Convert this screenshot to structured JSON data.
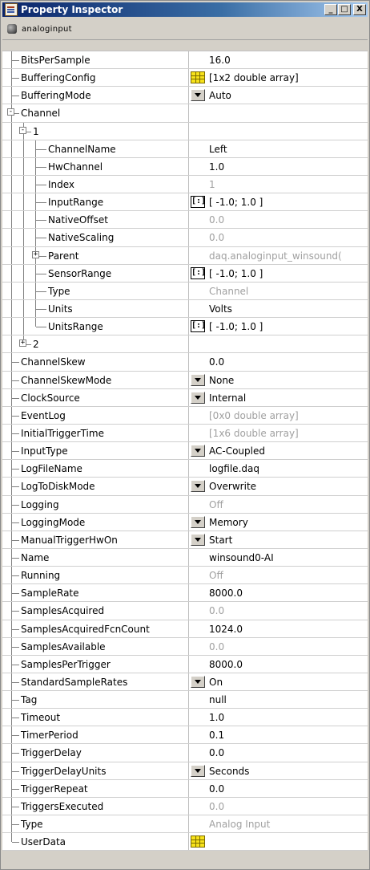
{
  "window": {
    "title": "Property Inspector",
    "controls": [
      "_",
      "□",
      "X"
    ]
  },
  "object": {
    "name": "analoginput",
    "icon": "object-icon"
  },
  "properties": [
    {
      "name": "BitsPerSample",
      "depth": 0,
      "value": "16.0",
      "readonly": false,
      "widget": null
    },
    {
      "name": "BufferingConfig",
      "depth": 0,
      "value": "[1x2  double array]",
      "readonly": false,
      "widget": "table"
    },
    {
      "name": "BufferingMode",
      "depth": 0,
      "value": "Auto",
      "readonly": false,
      "widget": "dropdown"
    },
    {
      "name": "Channel",
      "depth": 0,
      "value": "",
      "readonly": false,
      "widget": null,
      "expander": "-"
    },
    {
      "name": "1",
      "depth": 1,
      "value": "",
      "readonly": false,
      "widget": null,
      "expander": "-"
    },
    {
      "name": "ChannelName",
      "depth": 2,
      "value": "Left",
      "readonly": false,
      "widget": null
    },
    {
      "name": "HwChannel",
      "depth": 2,
      "value": "1.0",
      "readonly": false,
      "widget": null
    },
    {
      "name": "Index",
      "depth": 2,
      "value": "1",
      "readonly": true,
      "widget": null
    },
    {
      "name": "InputRange",
      "depth": 2,
      "value": "[ -1.0; 1.0 ]",
      "readonly": false,
      "widget": "range"
    },
    {
      "name": "NativeOffset",
      "depth": 2,
      "value": "0.0",
      "readonly": true,
      "widget": null
    },
    {
      "name": "NativeScaling",
      "depth": 2,
      "value": "0.0",
      "readonly": true,
      "widget": null
    },
    {
      "name": "Parent",
      "depth": 2,
      "value": "daq.analoginput_winsound(",
      "readonly": true,
      "widget": null,
      "expander": "+"
    },
    {
      "name": "SensorRange",
      "depth": 2,
      "value": "[ -1.0; 1.0 ]",
      "readonly": false,
      "widget": "range"
    },
    {
      "name": "Type",
      "depth": 2,
      "value": "Channel",
      "readonly": true,
      "widget": null
    },
    {
      "name": "Units",
      "depth": 2,
      "value": "Volts",
      "readonly": false,
      "widget": null
    },
    {
      "name": "UnitsRange",
      "depth": 2,
      "value": "[ -1.0; 1.0 ]",
      "readonly": false,
      "widget": "range"
    },
    {
      "name": "2",
      "depth": 1,
      "value": "",
      "readonly": false,
      "widget": null,
      "expander": "+"
    },
    {
      "name": "ChannelSkew",
      "depth": 0,
      "value": "0.0",
      "readonly": false,
      "widget": null
    },
    {
      "name": "ChannelSkewMode",
      "depth": 0,
      "value": "None",
      "readonly": false,
      "widget": "dropdown"
    },
    {
      "name": "ClockSource",
      "depth": 0,
      "value": "Internal",
      "readonly": false,
      "widget": "dropdown"
    },
    {
      "name": "EventLog",
      "depth": 0,
      "value": "[0x0  double array]",
      "readonly": true,
      "widget": null
    },
    {
      "name": "InitialTriggerTime",
      "depth": 0,
      "value": "[1x6  double array]",
      "readonly": true,
      "widget": null
    },
    {
      "name": "InputType",
      "depth": 0,
      "value": "AC-Coupled",
      "readonly": false,
      "widget": "dropdown"
    },
    {
      "name": "LogFileName",
      "depth": 0,
      "value": "logfile.daq",
      "readonly": false,
      "widget": null
    },
    {
      "name": "LogToDiskMode",
      "depth": 0,
      "value": "Overwrite",
      "readonly": false,
      "widget": "dropdown"
    },
    {
      "name": "Logging",
      "depth": 0,
      "value": "Off",
      "readonly": true,
      "widget": null
    },
    {
      "name": "LoggingMode",
      "depth": 0,
      "value": "Memory",
      "readonly": false,
      "widget": "dropdown"
    },
    {
      "name": "ManualTriggerHwOn",
      "depth": 0,
      "value": "Start",
      "readonly": false,
      "widget": "dropdown"
    },
    {
      "name": "Name",
      "depth": 0,
      "value": "winsound0-AI",
      "readonly": false,
      "widget": null
    },
    {
      "name": "Running",
      "depth": 0,
      "value": "Off",
      "readonly": true,
      "widget": null
    },
    {
      "name": "SampleRate",
      "depth": 0,
      "value": "8000.0",
      "readonly": false,
      "widget": null
    },
    {
      "name": "SamplesAcquired",
      "depth": 0,
      "value": "0.0",
      "readonly": true,
      "widget": null
    },
    {
      "name": "SamplesAcquiredFcnCount",
      "depth": 0,
      "value": "1024.0",
      "readonly": false,
      "widget": null
    },
    {
      "name": "SamplesAvailable",
      "depth": 0,
      "value": "0.0",
      "readonly": true,
      "widget": null
    },
    {
      "name": "SamplesPerTrigger",
      "depth": 0,
      "value": "8000.0",
      "readonly": false,
      "widget": null
    },
    {
      "name": "StandardSampleRates",
      "depth": 0,
      "value": "On",
      "readonly": false,
      "widget": "dropdown"
    },
    {
      "name": "Tag",
      "depth": 0,
      "value": "null",
      "readonly": false,
      "widget": null
    },
    {
      "name": "Timeout",
      "depth": 0,
      "value": "1.0",
      "readonly": false,
      "widget": null
    },
    {
      "name": "TimerPeriod",
      "depth": 0,
      "value": "0.1",
      "readonly": false,
      "widget": null
    },
    {
      "name": "TriggerDelay",
      "depth": 0,
      "value": "0.0",
      "readonly": false,
      "widget": null
    },
    {
      "name": "TriggerDelayUnits",
      "depth": 0,
      "value": "Seconds",
      "readonly": false,
      "widget": "dropdown"
    },
    {
      "name": "TriggerRepeat",
      "depth": 0,
      "value": "0.0",
      "readonly": false,
      "widget": null
    },
    {
      "name": "TriggersExecuted",
      "depth": 0,
      "value": "0.0",
      "readonly": true,
      "widget": null
    },
    {
      "name": "Type",
      "depth": 0,
      "value": "Analog Input",
      "readonly": true,
      "widget": null
    },
    {
      "name": "UserData",
      "depth": 0,
      "value": "",
      "readonly": false,
      "widget": "table"
    }
  ]
}
